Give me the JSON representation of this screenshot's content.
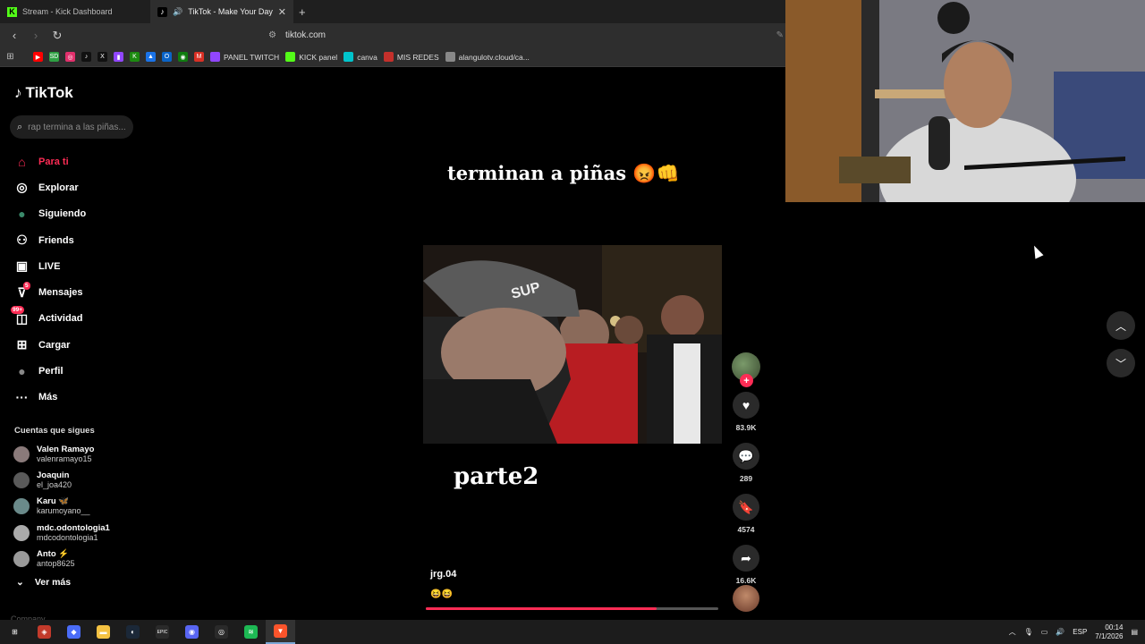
{
  "browser": {
    "tabs": [
      {
        "title": "Stream - Kick Dashboard",
        "active": false
      },
      {
        "title": "TikTok - Make Your Day",
        "active": true
      }
    ],
    "url": "tiktok.com",
    "bookmarks": [
      {
        "label": "PANEL TWITCH",
        "color": "#9146ff"
      },
      {
        "label": "KICK panel",
        "color": "#53fc18"
      },
      {
        "label": "canva",
        "color": "#00c4cc"
      },
      {
        "label": "MIS REDES",
        "color": "#c4302b"
      },
      {
        "label": "alangulotv.cloud/ca...",
        "color": "#888888"
      }
    ],
    "bookmark_icons": [
      {
        "name": "youtube-icon",
        "color": "#ff0000",
        "glyph": "▶"
      },
      {
        "name": "sd-icon",
        "color": "#2ea043",
        "glyph": "SD"
      },
      {
        "name": "instagram-icon",
        "color": "#e1306c",
        "glyph": "◎"
      },
      {
        "name": "tiktok-icon",
        "color": "#111111",
        "glyph": "♪"
      },
      {
        "name": "x-icon",
        "color": "#111111",
        "glyph": "X"
      },
      {
        "name": "twitch-icon",
        "color": "#9146ff",
        "glyph": "▮"
      },
      {
        "name": "kick-icon",
        "color": "#1c8a10",
        "glyph": "K"
      },
      {
        "name": "drive-icon",
        "color": "#1a73e8",
        "glyph": "▲"
      },
      {
        "name": "outlook-icon",
        "color": "#0a64c8",
        "glyph": "O"
      },
      {
        "name": "xbox-icon",
        "color": "#107c10",
        "glyph": "◉"
      },
      {
        "name": "gmail-icon",
        "color": "#d93025",
        "glyph": "M"
      }
    ]
  },
  "tiktok": {
    "brand": "TikTok",
    "search_placeholder": "rap termina a las piñas...",
    "nav": [
      {
        "label": "Para ti",
        "icon": "home-icon",
        "active": true
      },
      {
        "label": "Explorar",
        "icon": "compass-icon"
      },
      {
        "label": "Siguiendo",
        "icon": "following-avatar-icon"
      },
      {
        "label": "Friends",
        "icon": "friends-icon"
      },
      {
        "label": "LIVE",
        "icon": "live-icon"
      },
      {
        "label": "Mensajes",
        "icon": "messages-icon",
        "badge": "5"
      },
      {
        "label": "Actividad",
        "icon": "activity-icon",
        "badge": "99+"
      },
      {
        "label": "Cargar",
        "icon": "upload-icon"
      },
      {
        "label": "Perfil",
        "icon": "profile-icon"
      },
      {
        "label": "Más",
        "icon": "more-icon"
      }
    ],
    "following_title": "Cuentas que sigues",
    "following": [
      {
        "name": "Valen Ramayo",
        "handle": "valenramayo15"
      },
      {
        "name": "Joaquin",
        "handle": "el_joa420"
      },
      {
        "name": "Karu 🦋",
        "handle": "karumoyano__"
      },
      {
        "name": "mdc.odontologia1",
        "handle": "mdcodontologia1"
      },
      {
        "name": "Anto ⚡",
        "handle": "antop8625"
      }
    ],
    "ver_mas": "Ver más",
    "company": "Company"
  },
  "video": {
    "caption_top": "terminan a piñas 😡👊",
    "overlay_text": "parte2",
    "author": "jrg.04",
    "description": "😆😆",
    "progress": 0.79,
    "likes": "83.9K",
    "comments": "289",
    "saves": "4574",
    "shares": "16.6K"
  },
  "taskbar": {
    "lang": "ESP",
    "time": "00:14",
    "date": "7/1/2026",
    "apps": [
      {
        "name": "windows-start-icon",
        "color": "#1c1c1c",
        "glyph": "⊞"
      },
      {
        "name": "brave-shield-icon",
        "color": "#c23a2b",
        "glyph": "◈"
      },
      {
        "name": "copilot-icon",
        "color": "#4a6cf7",
        "glyph": "◆"
      },
      {
        "name": "file-explorer-icon",
        "color": "#f5c242",
        "glyph": "▬"
      },
      {
        "name": "steam-icon",
        "color": "#1b2838",
        "glyph": "◐"
      },
      {
        "name": "epic-games-icon",
        "color": "#2a2a2a",
        "glyph": "EPIC"
      },
      {
        "name": "discord-icon",
        "color": "#5865f2",
        "glyph": "◉"
      },
      {
        "name": "obs-icon",
        "color": "#2a2a2a",
        "glyph": "◎"
      },
      {
        "name": "spotify-icon",
        "color": "#1db954",
        "glyph": "≋"
      },
      {
        "name": "brave-browser-icon",
        "color": "#fb542b",
        "glyph": "▼"
      }
    ]
  }
}
